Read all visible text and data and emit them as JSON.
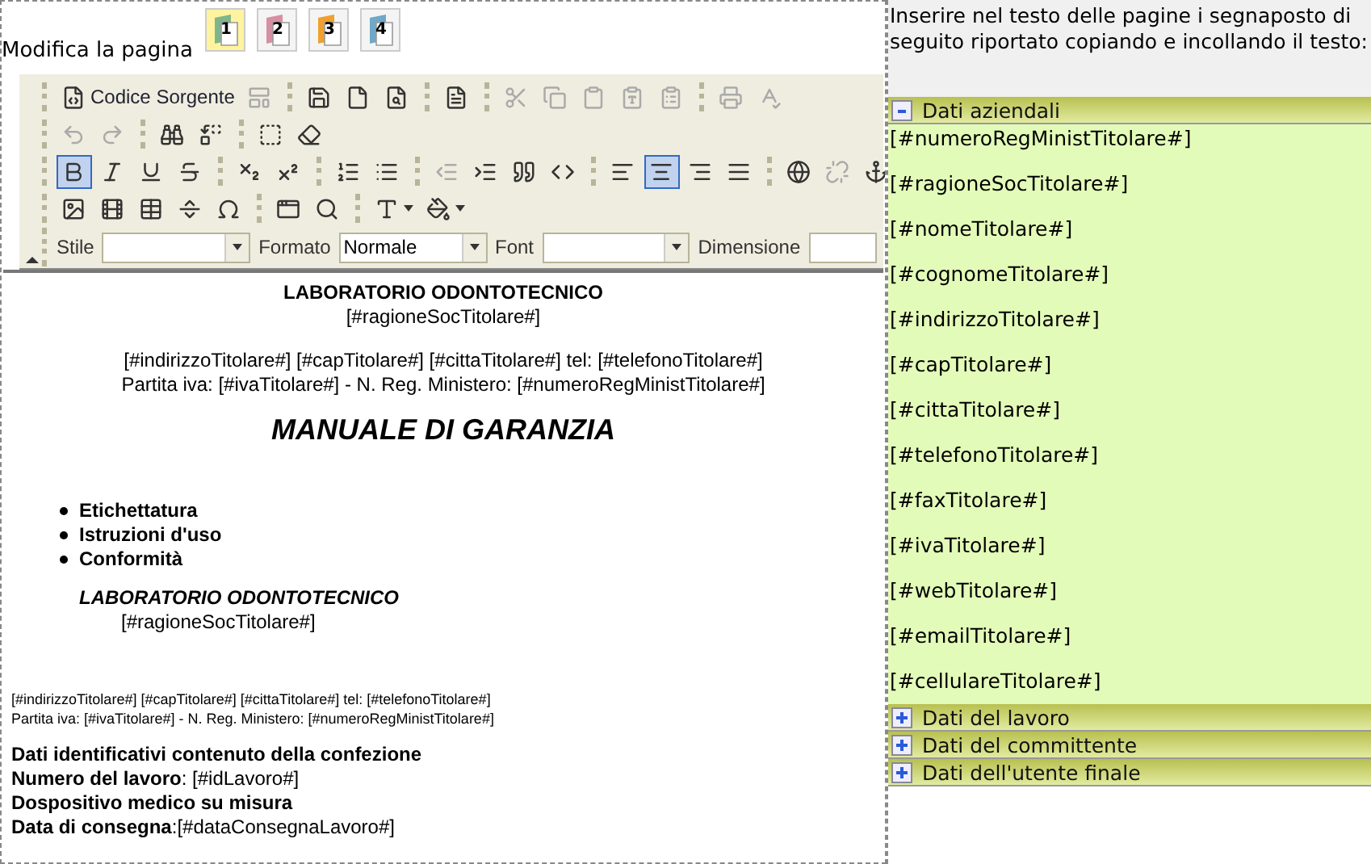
{
  "editor_panel": {
    "title": "Modifica la pagina",
    "page_buttons": [
      {
        "label": "1",
        "selected": true,
        "color": "#7fb58a"
      },
      {
        "label": "2",
        "selected": false,
        "color": "#d68fa3"
      },
      {
        "label": "3",
        "selected": false,
        "color": "#f0a030"
      },
      {
        "label": "4",
        "selected": false,
        "color": "#6fa8c8"
      }
    ],
    "toolbar": {
      "rows": [
        {
          "groups": [
            {
              "buttons": [
                {
                  "label": "Codice Sorgente",
                  "disabled": false
                },
                {
                  "disabled": true
                }
              ]
            },
            {
              "buttons": [
                {
                  "disabled": false
                },
                {
                  "disabled": false
                },
                {
                  "disabled": false
                }
              ]
            },
            {
              "buttons": [
                {
                  "disabled": false
                }
              ]
            },
            {
              "buttons": [
                {
                  "disabled": true
                },
                {
                  "disabled": true
                },
                {
                  "disabled": true
                },
                {
                  "disabled": true
                },
                {
                  "disabled": true
                }
              ]
            },
            {
              "buttons": [
                {
                  "disabled": true
                },
                {
                  "disabled": true
                }
              ]
            }
          ]
        },
        {
          "groups": [
            {
              "buttons": [
                {
                  "disabled": true
                },
                {
                  "disabled": true
                }
              ]
            },
            {
              "buttons": [
                {
                  "disabled": false
                },
                {
                  "disabled": false
                }
              ]
            },
            {
              "buttons": [
                {
                  "disabled": false
                },
                {
                  "disabled": false
                }
              ]
            }
          ]
        },
        {
          "groups": [
            {
              "buttons": [
                {
                  "disabled": false,
                  "selected": true
                },
                {
                  "disabled": false,
                  "selected": false
                },
                {
                  "disabled": false,
                  "selected": false
                },
                {
                  "disabled": false,
                  "selected": false
                }
              ]
            },
            {
              "buttons": [
                {
                  "disabled": false,
                  "selected": false
                },
                {
                  "disabled": false,
                  "selected": false
                }
              ]
            },
            {
              "buttons": [
                {
                  "disabled": false,
                  "selected": false
                },
                {
                  "disabled": false,
                  "selected": false
                }
              ]
            },
            {
              "buttons": [
                {
                  "disabled": true,
                  "selected": false
                },
                {
                  "disabled": false,
                  "selected": false
                },
                {
                  "disabled": false,
                  "selected": false
                },
                {
                  "disabled": false,
                  "selected": false
                }
              ]
            },
            {
              "buttons": [
                {
                  "disabled": false,
                  "selected": false
                },
                {
                  "disabled": false,
                  "selected": true
                },
                {
                  "disabled": false,
                  "selected": false
                },
                {
                  "disabled": false,
                  "selected": false
                }
              ]
            },
            {
              "buttons": [
                {
                  "disabled": false,
                  "selected": false
                },
                {
                  "disabled": true,
                  "selected": false
                },
                {
                  "disabled": false,
                  "selected": false
                }
              ]
            }
          ]
        },
        {
          "groups": [
            {
              "buttons": [
                {
                  "disabled": false
                },
                {
                  "disabled": false
                },
                {
                  "disabled": false
                },
                {
                  "disabled": false
                },
                {
                  "disabled": false
                }
              ]
            },
            {
              "buttons": [
                {
                  "disabled": false
                },
                {
                  "disabled": false
                }
              ]
            },
            {
              "buttons": [
                {
                  "disabled": false
                },
                {
                  "disabled": false
                }
              ]
            }
          ]
        }
      ],
      "combos": [
        {
          "label": "Stile"
        },
        {
          "label": "Formato",
          "value": "Normale"
        },
        {
          "label": "Font"
        },
        {
          "label": "Dimensione"
        }
      ]
    },
    "document": {
      "header_title": "LABORATORIO ODONTOTECNICO",
      "header_subtitle": "[#ragioneSocTitolare#]",
      "address_lines": [
        "[#indirizzoTitolare#] [#capTitolare#] [#cittaTitolare#] tel: [#telefonoTitolare#]",
        "Partita iva: [#ivaTitolare#] - N. Reg. Ministero: [#numeroRegMinistTitolare#]"
      ],
      "main_title": "MANUALE DI GARANZIA",
      "bullets": [
        "Etichettatura",
        "Istruzioni d'uso",
        "Conformità"
      ],
      "block_title": "LABORATORIO ODONTOTECNICO",
      "block_subtitle": "[#ragioneSocTitolare#]",
      "small_lines": [
        "[#indirizzoTitolare#] [#capTitolare#] [#cittaTitolare#] tel: [#telefonoTitolare#]",
        "Partita iva: [#ivaTitolare#] - N. Reg. Ministero: [#numeroRegMinistTitolare#]"
      ],
      "details": [
        {
          "kind": "heading",
          "text": "Dati identificativi contenuto della confezione"
        },
        {
          "kind": "field",
          "text": "**Numero del lavoro**: [#idLavoro#]"
        },
        {
          "kind": "heading",
          "text": "Dospositivo medico su misura"
        },
        {
          "kind": "field",
          "text": "**Data di consegna**:[#dataConsegnaLavoro#]"
        }
      ]
    }
  },
  "placeholder_panel": {
    "instructions": "Inserire nel testo delle pagine i segnaposto di seguito riportato copiando e incollando il testo:",
    "sections": [
      {
        "title": "Dati aziendali",
        "expanded": true,
        "items": [
          "[#numeroRegMinistTitolare#]",
          "[#ragioneSocTitolare#]",
          "[#nomeTitolare#]",
          "[#cognomeTitolare#]",
          "[#indirizzoTitolare#]",
          "[#capTitolare#]",
          "[#cittaTitolare#]",
          "[#telefonoTitolare#]",
          "[#faxTitolare#]",
          "[#ivaTitolare#]",
          "[#webTitolare#]",
          "[#emailTitolare#]",
          "[#cellulareTitolare#]"
        ]
      },
      {
        "title": "Dati del lavoro",
        "expanded": false
      },
      {
        "title": "Dati del committente",
        "expanded": false
      },
      {
        "title": "Dati dell'utente finale",
        "expanded": false
      }
    ]
  }
}
